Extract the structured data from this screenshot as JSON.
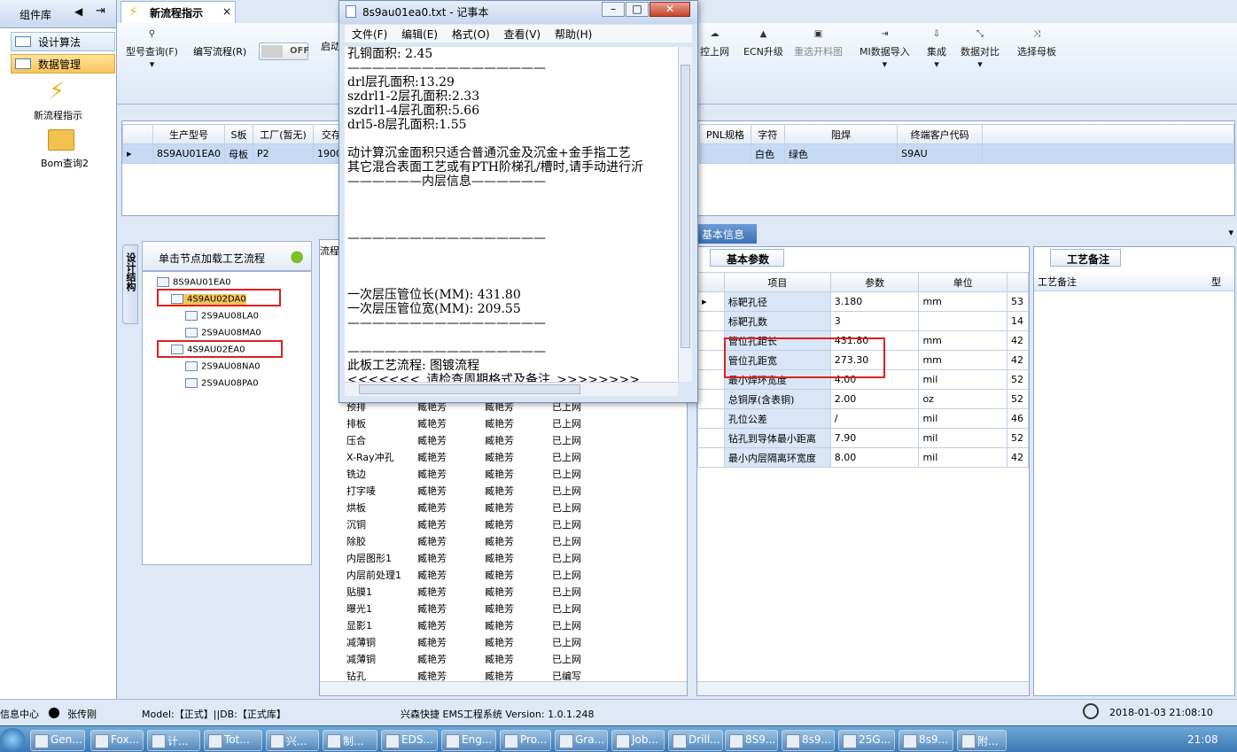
{
  "sidebar": {
    "title": "组件库",
    "items": [
      {
        "label": "设计算法"
      },
      {
        "label": "数据管理"
      }
    ],
    "tools": [
      {
        "label": "新流程指示"
      },
      {
        "label": "Bom查询2"
      }
    ]
  },
  "tab": {
    "label": "新流程指示"
  },
  "ribbon": {
    "query": "型号查询(F)",
    "edit": "编写流程(R)",
    "toggle": "OFF",
    "start": "启动",
    "buttons": [
      "控上网",
      "ECN升级",
      "重选开料图",
      "MI数据导入",
      "集成",
      "数据对比",
      "选择母板"
    ]
  },
  "topgrid": {
    "headers": [
      "生产型号",
      "S板",
      "工厂(暂无)",
      "交存"
    ],
    "row": [
      "8S9AU01EA0",
      "母板",
      "P2",
      "1900/"
    ],
    "headers2": [
      "PNL规格",
      "字符",
      "阻焊",
      "终端客户代码"
    ],
    "row2": [
      "白色",
      "绿色",
      "S9AU"
    ]
  },
  "tree": {
    "side_tab": "设计结构",
    "header": "单击节点加载工艺流程",
    "nodes": [
      "8S9AU01EA0",
      "4S9AU02DA0",
      "2S9AU08LA0",
      "2S9AU08MA0",
      "4S9AU02EA0",
      "2S9AU08NA0",
      "2S9AU08PA0"
    ]
  },
  "flow": {
    "header": "流程",
    "rows": [
      [
        "预排",
        "臧艳芳",
        "臧艳芳",
        "已上网"
      ],
      [
        "排板",
        "臧艳芳",
        "臧艳芳",
        "已上网"
      ],
      [
        "压合",
        "臧艳芳",
        "臧艳芳",
        "已上网"
      ],
      [
        "X-Ray冲孔",
        "臧艳芳",
        "臧艳芳",
        "已上网"
      ],
      [
        "铣边",
        "臧艳芳",
        "臧艳芳",
        "已上网"
      ],
      [
        "打字唛",
        "臧艳芳",
        "臧艳芳",
        "已上网"
      ],
      [
        "烘板",
        "臧艳芳",
        "臧艳芳",
        "已上网"
      ],
      [
        "沉铜",
        "臧艳芳",
        "臧艳芳",
        "已上网"
      ],
      [
        "除胶",
        "臧艳芳",
        "臧艳芳",
        "已上网"
      ],
      [
        "内层图形1",
        "臧艳芳",
        "臧艳芳",
        "已上网"
      ],
      [
        "内层前处理1",
        "臧艳芳",
        "臧艳芳",
        "已上网"
      ],
      [
        "贴膜1",
        "臧艳芳",
        "臧艳芳",
        "已上网"
      ],
      [
        "曝光1",
        "臧艳芳",
        "臧艳芳",
        "已上网"
      ],
      [
        "显影1",
        "臧艳芳",
        "臧艳芳",
        "已上网"
      ],
      [
        "减薄铜",
        "臧艳芳",
        "臧艳芳",
        "已上网"
      ],
      [
        "减薄铜",
        "臧艳芳",
        "臧艳芳",
        "已上网"
      ],
      [
        "钻孔",
        "臧艳芳",
        "臧艳芳",
        "已编写"
      ]
    ]
  },
  "info": {
    "tab": "基本信息",
    "subtab": "基本参数",
    "headers": [
      "项目",
      "参数",
      "单位"
    ],
    "rows": [
      [
        "标靶孔径",
        "3.180",
        "mm",
        "53"
      ],
      [
        "标靶孔数",
        "3",
        "",
        "14"
      ],
      [
        "管位孔距长",
        "431.80",
        "mm",
        "42"
      ],
      [
        "管位孔距宽",
        "273.30",
        "mm",
        "42"
      ],
      [
        "最小焊环宽度",
        "4.00",
        "mil",
        "52"
      ],
      [
        "总铜厚(含表铜)",
        "2.00",
        "oz",
        "52"
      ],
      [
        "孔位公差",
        "/",
        "mil",
        "46"
      ],
      [
        "钻孔到导体最小距离",
        "7.90",
        "mil",
        "52"
      ],
      [
        "最小内层隔离环宽度",
        "8.00",
        "mil",
        "42"
      ]
    ]
  },
  "notes": {
    "tab": "工艺备注",
    "header": "工艺备注",
    "col": "型"
  },
  "notepad": {
    "title": "8s9au01ea0.txt - 记事本",
    "menu": [
      "文件(F)",
      "编辑(E)",
      "格式(O)",
      "查看(V)",
      "帮助(H)"
    ],
    "text": "孔铜面积: 2.45\n————————————————\ndrl层孔面积:13.29\nszdrl1-2层孔面积:2.33\nszdrl1-4层孔面积:5.66\ndrl5-8层孔面积:1.55\n\n动计算沉金面积只适合普通沉金及沉金+金手指工艺\n其它混合表面工艺或有PTH阶梯孔/槽时,请手动进行沂\n——————内层信息——————\n\n\n\n————————————————\n\n\n\n一次层压管位长(MM): 431.80\n一次层压管位宽(MM): 209.55\n————————————————\n\n————————————————\n此板工艺流程: 图镀流程\n<<<<<<<_请检查周期格式及备注_>>>>>>>>"
  },
  "status": {
    "left": "信息中心",
    "user": "张传刚",
    "model": "Model:【正式】||DB:【正式库】",
    "app": "兴森快捷 EMS工程系统 Version: 1.0.1.248",
    "datetime": "2018-01-03 21:08:10"
  },
  "taskbar": {
    "items": [
      "Gen...",
      "Fox...",
      "计...",
      "Tot...",
      "兴...",
      "制...",
      "EDS...",
      "Eng...",
      "Pro...",
      "Gra...",
      "Job...",
      "Drill...",
      "8S9...",
      "8s9...",
      "25G...",
      "8s9...",
      "附..."
    ],
    "clock": "21:08"
  }
}
